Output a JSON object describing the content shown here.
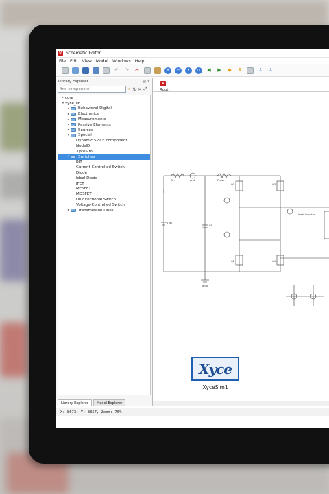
{
  "window": {
    "title": "Schematic Editor"
  },
  "menu": [
    "File",
    "Edit",
    "View",
    "Model",
    "Windows",
    "Help"
  ],
  "toolbar_icons": [
    "new-icon",
    "open-icon",
    "save-icon",
    "save-as-icon",
    "print-icon",
    "undo-icon",
    "redo-icon",
    "cut-icon",
    "copy-icon",
    "paste-icon",
    "zoom-in-icon",
    "zoom-out-icon",
    "zoom-fit-icon",
    "zoom-region-icon",
    "go-back-icon",
    "go-forward-icon",
    "move-up-icon",
    "move-down-icon",
    "properties-icon",
    "import-icon",
    "export-icon"
  ],
  "library": {
    "title": "Library Explorer",
    "search_placeholder": "find component",
    "tree": [
      {
        "label": "core",
        "level": 0,
        "arrow": "▸",
        "folder": false
      },
      {
        "label": "xyce_lib",
        "level": 0,
        "arrow": "▾",
        "folder": false
      },
      {
        "label": "Behavioral Digital",
        "level": 1,
        "arrow": "▸",
        "folder": true
      },
      {
        "label": "Electronics",
        "level": 1,
        "arrow": "▸",
        "folder": true
      },
      {
        "label": "Measurements",
        "level": 1,
        "arrow": "▸",
        "folder": true
      },
      {
        "label": "Passive Elements",
        "level": 1,
        "arrow": "▸",
        "folder": true
      },
      {
        "label": "Sources",
        "level": 1,
        "arrow": "▸",
        "folder": true
      },
      {
        "label": "Special",
        "level": 1,
        "arrow": "▾",
        "folder": true
      },
      {
        "label": "Dynamic SPICE component",
        "level": 2,
        "arrow": "",
        "folder": false
      },
      {
        "label": "NodeID",
        "level": 2,
        "arrow": "",
        "folder": false
      },
      {
        "label": "XyceSim",
        "level": 2,
        "arrow": "",
        "folder": false
      },
      {
        "label": "Switches",
        "level": 1,
        "arrow": "▾",
        "folder": true,
        "selected": true
      },
      {
        "label": "BJT",
        "level": 2,
        "arrow": "",
        "folder": false
      },
      {
        "label": "Current-Controlled Switch",
        "level": 2,
        "arrow": "",
        "folder": false
      },
      {
        "label": "Diode",
        "level": 2,
        "arrow": "",
        "folder": false
      },
      {
        "label": "Ideal Diode",
        "level": 2,
        "arrow": "",
        "folder": false
      },
      {
        "label": "JFET",
        "level": 2,
        "arrow": "",
        "folder": false
      },
      {
        "label": "MESFET",
        "level": 2,
        "arrow": "",
        "folder": false
      },
      {
        "label": "MOSFET",
        "level": 2,
        "arrow": "",
        "folder": false
      },
      {
        "label": "Unidirectional Switch",
        "level": 2,
        "arrow": "",
        "folder": false
      },
      {
        "label": "Voltage-Controlled Switch",
        "level": 2,
        "arrow": "",
        "folder": false
      },
      {
        "label": "Transmission Lines",
        "level": 1,
        "arrow": "▸",
        "folder": true
      }
    ],
    "tabs": [
      "Library Explorer",
      "Model Explorer"
    ]
  },
  "canvas": {
    "breadcrumb": "Root",
    "labels": {
      "rin": "Rin",
      "amp": "Am1",
      "phase": "Phase",
      "c1": "Cll",
      "gnd": "gnd1",
      "ideal": "Ideal Inductor",
      "v_in": "V_dc",
      "q1": "Q1",
      "q2": "Q2",
      "q3": "Q3",
      "q4": "Q4"
    },
    "xyce_logo": "Xyce",
    "xyce_caption": "XyceSim1"
  },
  "status": "X:  8673, Y:  8857, Zoom: 76%"
}
